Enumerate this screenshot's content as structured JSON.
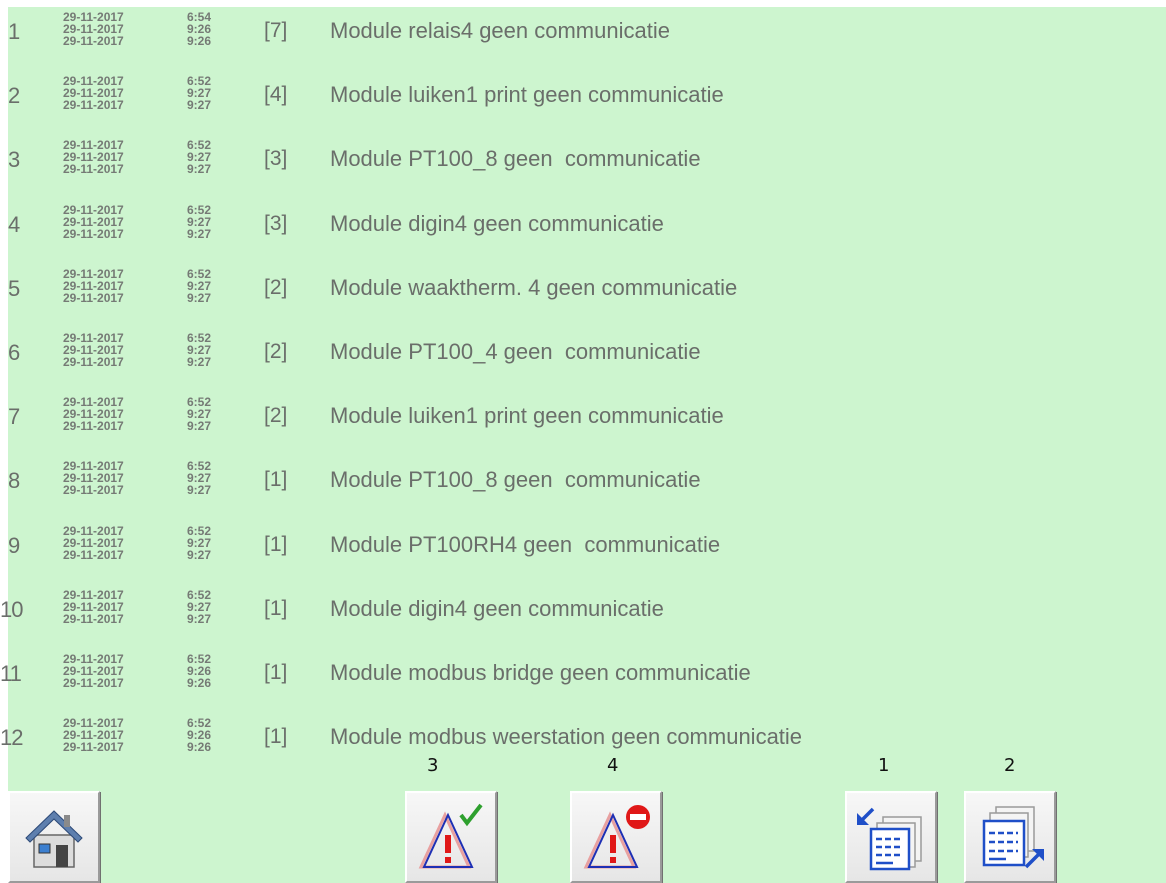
{
  "alarms": [
    {
      "index": "1",
      "count": "[7]",
      "message": "Module relais4 geen communicatie",
      "timestamps": [
        {
          "date": "29-11-2017",
          "time": "6:54"
        },
        {
          "date": "29-11-2017",
          "time": "9:26"
        },
        {
          "date": "29-11-2017",
          "time": "9:26"
        }
      ]
    },
    {
      "index": "2",
      "count": "[4]",
      "message": "Module luiken1 print geen communicatie",
      "timestamps": [
        {
          "date": "29-11-2017",
          "time": "6:52"
        },
        {
          "date": "29-11-2017",
          "time": "9:27"
        },
        {
          "date": "29-11-2017",
          "time": "9:27"
        }
      ]
    },
    {
      "index": "3",
      "count": "[3]",
      "message": "Module PT100_8 geen  communicatie",
      "timestamps": [
        {
          "date": "29-11-2017",
          "time": "6:52"
        },
        {
          "date": "29-11-2017",
          "time": "9:27"
        },
        {
          "date": "29-11-2017",
          "time": "9:27"
        }
      ]
    },
    {
      "index": "4",
      "count": "[3]",
      "message": "Module digin4 geen communicatie",
      "timestamps": [
        {
          "date": "29-11-2017",
          "time": "6:52"
        },
        {
          "date": "29-11-2017",
          "time": "9:27"
        },
        {
          "date": "29-11-2017",
          "time": "9:27"
        }
      ]
    },
    {
      "index": "5",
      "count": "[2]",
      "message": "Module waaktherm. 4 geen communicatie",
      "timestamps": [
        {
          "date": "29-11-2017",
          "time": "6:52"
        },
        {
          "date": "29-11-2017",
          "time": "9:27"
        },
        {
          "date": "29-11-2017",
          "time": "9:27"
        }
      ]
    },
    {
      "index": "6",
      "count": "[2]",
      "message": "Module PT100_4 geen  communicatie",
      "timestamps": [
        {
          "date": "29-11-2017",
          "time": "6:52"
        },
        {
          "date": "29-11-2017",
          "time": "9:27"
        },
        {
          "date": "29-11-2017",
          "time": "9:27"
        }
      ]
    },
    {
      "index": "7",
      "count": "[2]",
      "message": "Module luiken1 print geen communicatie",
      "timestamps": [
        {
          "date": "29-11-2017",
          "time": "6:52"
        },
        {
          "date": "29-11-2017",
          "time": "9:27"
        },
        {
          "date": "29-11-2017",
          "time": "9:27"
        }
      ]
    },
    {
      "index": "8",
      "count": "[1]",
      "message": "Module PT100_8 geen  communicatie",
      "timestamps": [
        {
          "date": "29-11-2017",
          "time": "6:52"
        },
        {
          "date": "29-11-2017",
          "time": "9:27"
        },
        {
          "date": "29-11-2017",
          "time": "9:27"
        }
      ]
    },
    {
      "index": "9",
      "count": "[1]",
      "message": "Module PT100RH4 geen  communicatie",
      "timestamps": [
        {
          "date": "29-11-2017",
          "time": "6:52"
        },
        {
          "date": "29-11-2017",
          "time": "9:27"
        },
        {
          "date": "29-11-2017",
          "time": "9:27"
        }
      ]
    },
    {
      "index": "10",
      "count": "[1]",
      "message": "Module digin4 geen communicatie",
      "timestamps": [
        {
          "date": "29-11-2017",
          "time": "6:52"
        },
        {
          "date": "29-11-2017",
          "time": "9:27"
        },
        {
          "date": "29-11-2017",
          "time": "9:27"
        }
      ]
    },
    {
      "index": "11",
      "count": "[1]",
      "message": "Module modbus bridge geen communicatie",
      "timestamps": [
        {
          "date": "29-11-2017",
          "time": "6:52"
        },
        {
          "date": "29-11-2017",
          "time": "9:26"
        },
        {
          "date": "29-11-2017",
          "time": "9:26"
        }
      ]
    },
    {
      "index": "12",
      "count": "[1]",
      "message": "Module modbus weerstation geen communicatie",
      "timestamps": [
        {
          "date": "29-11-2017",
          "time": "6:52"
        },
        {
          "date": "29-11-2017",
          "time": "9:26"
        },
        {
          "date": "29-11-2017",
          "time": "9:26"
        }
      ]
    }
  ],
  "toolbar": {
    "acknowledge_number": "3",
    "reset_number": "4",
    "page_back_number": "1",
    "page_forward_number": "2",
    "home_icon": "house-icon",
    "acknowledge_icon": "warning-check-icon",
    "reset_icon": "warning-stop-icon",
    "page_back_icon": "page-arrow-in-icon",
    "page_forward_icon": "page-arrow-out-icon"
  },
  "colors": {
    "background": "#cdf5cf",
    "text": "#6a6e6a",
    "check_green": "#2ea02e",
    "stop_red": "#e01818",
    "warning_blue": "#1e2fb4",
    "arrow_blue": "#1f4fc8"
  }
}
